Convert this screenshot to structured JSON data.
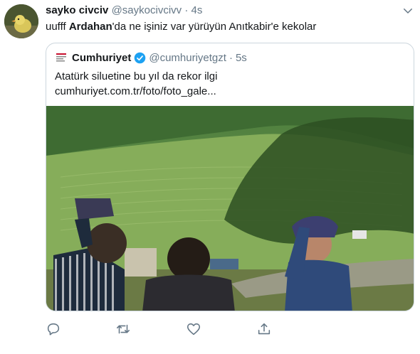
{
  "tweet": {
    "author_name": "sayko civciv",
    "author_handle": "@saykocivcivv",
    "separator": "·",
    "time": "4s",
    "text_before": "uufff ",
    "text_bold": "Ardahan",
    "text_after": "'da ne işiniz var yürüyün Anıtkabir'e kekolar"
  },
  "quote": {
    "name": "Cumhuriyet",
    "handle": "@cumhuriyetgzt",
    "separator": "·",
    "time": "5s",
    "line1": "Atatürk siluetine bu yıl da rekor ilgi",
    "line2": "cumhuriyet.com.tr/foto/foto_gale..."
  },
  "icons": {
    "reply": "reply-icon",
    "retweet": "retweet-icon",
    "like": "heart-icon",
    "share": "share-icon",
    "caret": "chevron-down-icon",
    "verified": "verified-badge-icon"
  },
  "colors": {
    "text": "#14171a",
    "secondary": "#657786",
    "verified": "#1da1f2",
    "border": "#ccd6dd"
  }
}
